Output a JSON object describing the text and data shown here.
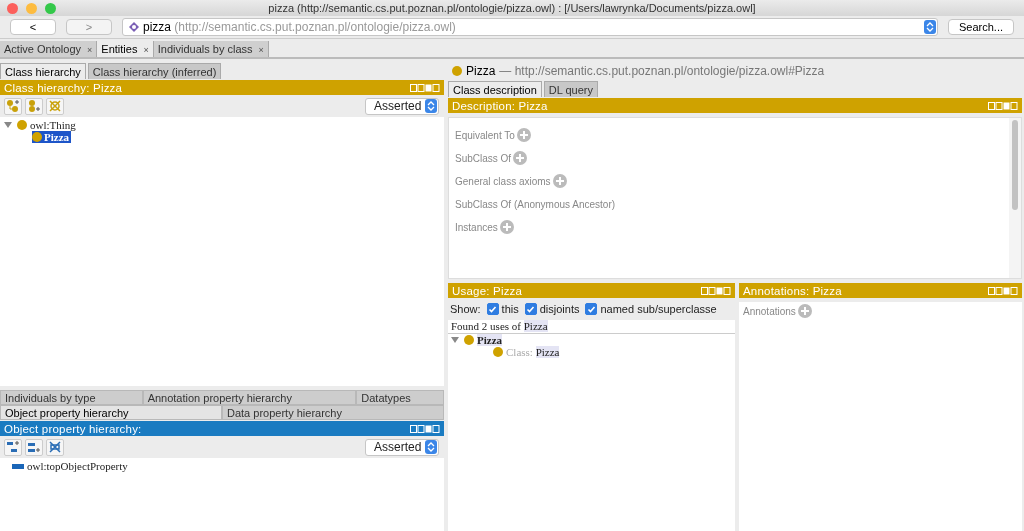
{
  "window": {
    "title": "pizza (http://semantic.cs.put.poznan.pl/ontologie/pizza.owl)  : [/Users/lawrynka/Documents/pizza.owl]"
  },
  "toolbar": {
    "back": "<",
    "forward": ">",
    "ontology_name": "pizza",
    "ontology_iri": "(http://semantic.cs.put.poznan.pl/ontologie/pizza.owl)",
    "search": "Search..."
  },
  "workspace_tabs": [
    {
      "label": "Active Ontology",
      "close": "×",
      "selected": false
    },
    {
      "label": "Entities",
      "close": "×",
      "selected": true
    },
    {
      "label": "Individuals by class",
      "close": "×",
      "selected": false
    }
  ],
  "class_panel": {
    "tabs": [
      {
        "label": "Class hierarchy",
        "selected": true
      },
      {
        "label": "Class hierarchy (inferred)",
        "selected": false
      }
    ],
    "header": "Class hierarchy: Pizza",
    "mode": "Asserted",
    "tree": [
      {
        "label": "owl:Thing",
        "expanded": true,
        "selected": false,
        "children": [
          {
            "label": "Pizza",
            "selected": true
          }
        ]
      }
    ]
  },
  "property_panel": {
    "tab_rows": [
      [
        {
          "label": "Individuals by type",
          "selected": false
        },
        {
          "label": "Annotation property hierarchy",
          "selected": false
        },
        {
          "label": "Datatypes",
          "selected": false
        }
      ],
      [
        {
          "label": "Object property hierarchy",
          "selected": true
        },
        {
          "label": "Data property hierarchy",
          "selected": false
        }
      ]
    ],
    "header": "Object property hierarchy:",
    "mode": "Asserted",
    "tree": [
      {
        "label": "owl:topObjectProperty"
      }
    ]
  },
  "entity": {
    "name": "Pizza",
    "iri": "— http://semantic.cs.put.poznan.pl/ontologie/pizza.owl#Pizza"
  },
  "entity_tabs": [
    {
      "label": "Class description",
      "selected": true
    },
    {
      "label": "DL query",
      "selected": false
    }
  ],
  "description": {
    "header": "Description: Pizza",
    "sections": [
      {
        "label": "Equivalent To",
        "addable": true
      },
      {
        "label": "SubClass Of",
        "addable": true
      },
      {
        "label": "General class axioms",
        "addable": true
      },
      {
        "label": "SubClass Of (Anonymous Ancestor)",
        "addable": false
      },
      {
        "label": "Instances",
        "addable": true
      }
    ]
  },
  "usage": {
    "header": "Usage: Pizza",
    "show_label": "Show:",
    "filters": [
      {
        "label": "this",
        "checked": true
      },
      {
        "label": "disjoints",
        "checked": true
      },
      {
        "label": "named sub/superclasse",
        "checked": true
      }
    ],
    "summary_prefix": "Found 2 uses of ",
    "summary_entity": "Pizza",
    "tree": [
      {
        "label": "Pizza",
        "expanded": true,
        "children": [
          {
            "prefix": "Class:",
            "label": "Pizza"
          }
        ]
      }
    ]
  },
  "annotations": {
    "header": "Annotations: Pizza",
    "sections": [
      {
        "label": "Annotations",
        "addable": true
      }
    ]
  }
}
